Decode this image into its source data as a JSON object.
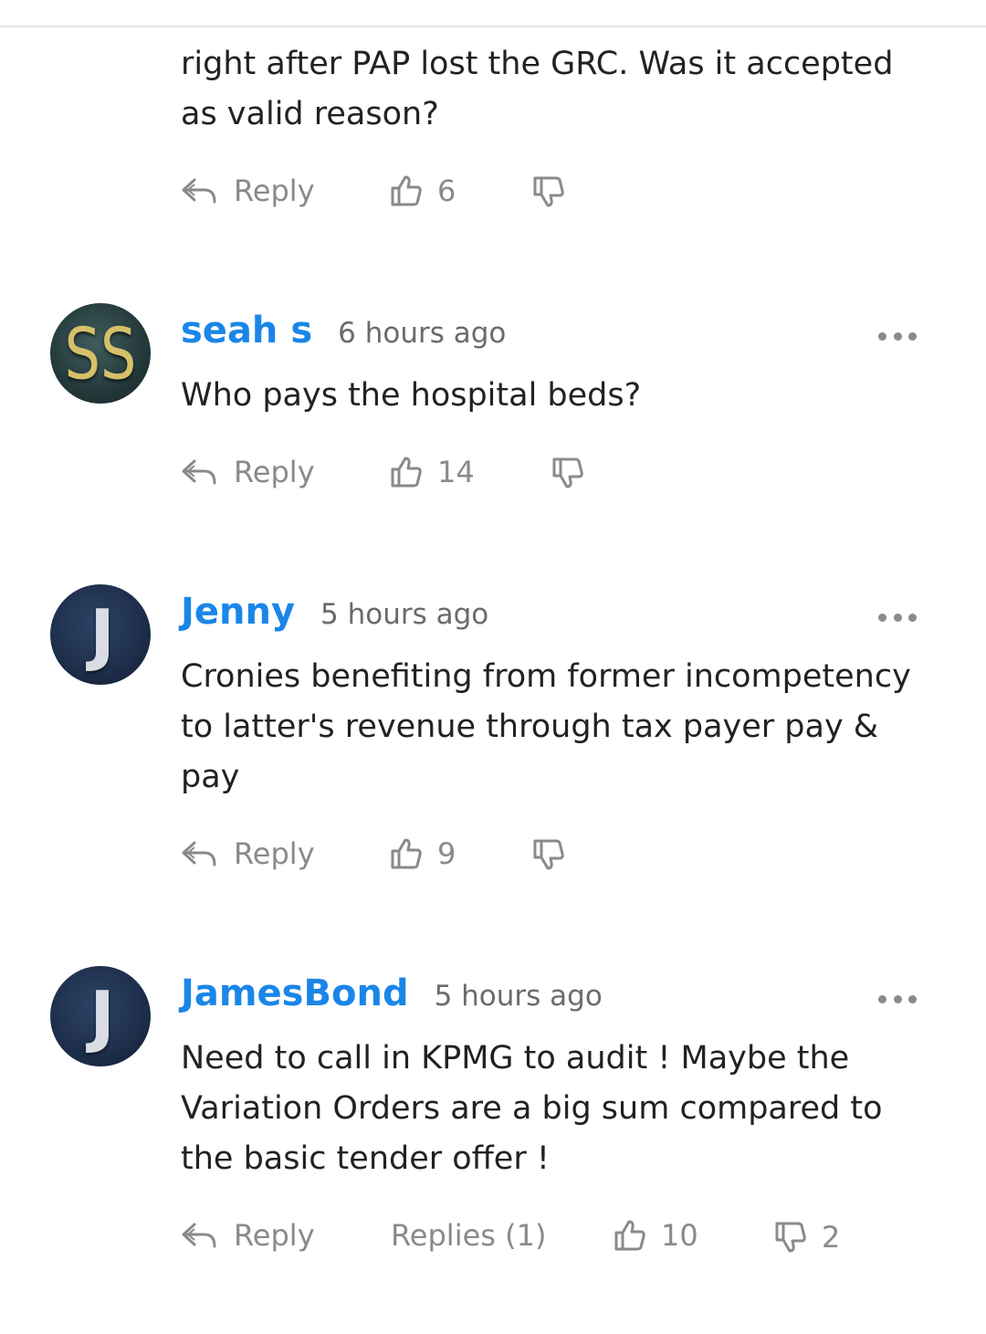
{
  "comments": [
    {
      "author": "",
      "time": "",
      "text": "right after PAP lost the GRC. Was it accepted as valid reason?",
      "reply_label": "Reply",
      "upvotes": "6",
      "downvotes": ""
    },
    {
      "author": "seah s",
      "time": "6 hours ago",
      "avatar_letter": "SS",
      "text": "Who pays the hospital beds?",
      "reply_label": "Reply",
      "upvotes": "14",
      "downvotes": ""
    },
    {
      "author": "Jenny",
      "time": "5 hours ago",
      "avatar_letter": "J",
      "text": "Cronies benefiting from former incompetency to latter's revenue through tax payer pay & pay",
      "reply_label": "Reply",
      "upvotes": "9",
      "downvotes": ""
    },
    {
      "author": "JamesBond",
      "time": "5 hours ago",
      "avatar_letter": "J",
      "text": "Need to call in KPMG to audit ! Maybe the Variation Orders are a big sum compared to the basic tender offer !",
      "reply_label": "Reply",
      "replies_label": "Replies (1)",
      "upvotes": "10",
      "downvotes": "2"
    }
  ],
  "colors": {
    "author": "#1a86e8",
    "meta": "#6b6b6b",
    "action": "#8a8a8a"
  },
  "icons": [
    "reply-icon",
    "thumbs-up-icon",
    "thumbs-down-icon",
    "more-options-icon"
  ]
}
